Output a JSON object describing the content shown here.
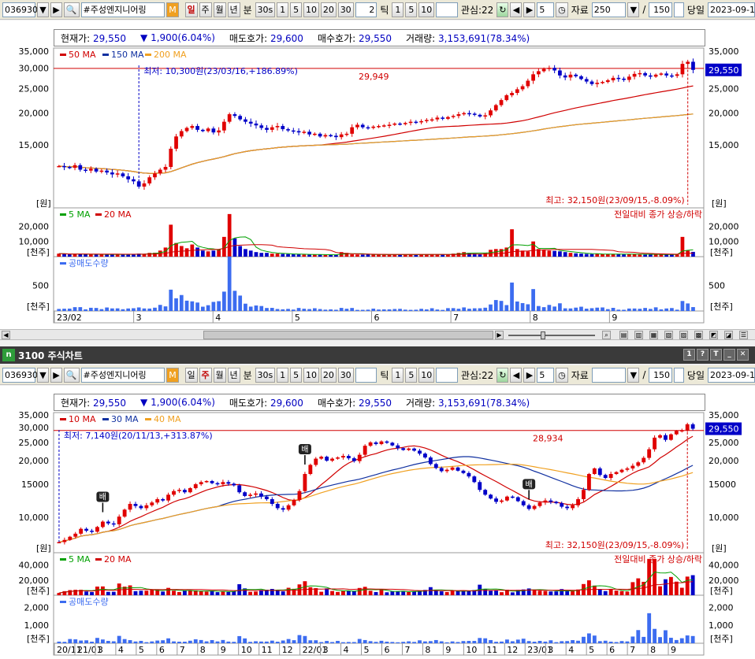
{
  "window_title": "3100 주식차트",
  "toolbar_top": {
    "code": "036930",
    "stock_name": "#주성엔지니어링",
    "period_tabs": [
      "일",
      "주",
      "월",
      "년"
    ],
    "active_period": "일",
    "min_label": "분",
    "sec_value": "30s",
    "intervals": [
      "1",
      "5",
      "10",
      "20",
      "30"
    ],
    "tick_value": "2",
    "tick_label": "틱",
    "tick_intervals": [
      "1",
      "5",
      "10"
    ],
    "interest_label": "관심:22",
    "spin_value": "5",
    "data_label": "자료",
    "data_count": "250",
    "slash": "/",
    "data_max": "150",
    "today_label": "당일",
    "date_value": "2023-09-1"
  },
  "toolbar_bottom": {
    "code": "036930",
    "stock_name": "#주성엔지니어링",
    "period_tabs": [
      "일",
      "주",
      "월",
      "년"
    ],
    "active_period": "주",
    "min_label": "분",
    "sec_value": "30s",
    "intervals": [
      "1",
      "5",
      "10",
      "20",
      "30"
    ],
    "tick_value": "",
    "tick_label": "틱",
    "tick_intervals": [
      "1",
      "5",
      "10"
    ],
    "interest_label": "관심:22",
    "spin_value": "5",
    "data_label": "자료",
    "slash": "/",
    "data_max": "150",
    "today_label": "당일",
    "date_value": "2023-09-1"
  },
  "info_bar": {
    "current_label": "현재가:",
    "current": "29,550",
    "change_arrow": "▼",
    "change": "1,900(6.04%)",
    "ask_label": "매도호가:",
    "ask": "29,600",
    "bid_label": "매수호가:",
    "bid": "29,550",
    "volume_label": "거래량:",
    "volume": "3,153,691(78.34%)"
  },
  "colors": {
    "up": "#e00000",
    "down": "#0000c8",
    "ma_red": "#d00000",
    "ma_blue": "#1030a0",
    "ma_orange": "#f0a020",
    "ma_green": "#00a000",
    "short_vol": "#3c6cf0"
  },
  "chart_data": [
    {
      "type": "candlestick",
      "name": "daily",
      "legend": [
        {
          "name": "50 MA",
          "color": "#d00000"
        },
        {
          "name": "150 MA",
          "color": "#1030a0"
        },
        {
          "name": "200 MA",
          "color": "#f0a020"
        }
      ],
      "y_ticks": [
        "35,000",
        "30,000",
        "25,000",
        "20,000",
        "15,000"
      ],
      "y_tick_values": [
        35000,
        30000,
        25000,
        20000,
        15000
      ],
      "y_unit": "[원]",
      "ylim": [
        8500,
        36000
      ],
      "current_price_label": "29,550",
      "current_price": 29550,
      "ref_line_value": 29949,
      "ref_line_label": "29,949",
      "low_annotation": "최저: 10,300원(23/03/16,+186.89%)",
      "high_annotation": "최고: 32,150원(23/09/15,-8.09%)",
      "x_labels": [
        "23/02",
        "3",
        "4",
        "5",
        "6",
        "7",
        "8",
        "9"
      ],
      "volume_legend": [
        {
          "name": "5 MA",
          "color": "#00a000"
        },
        {
          "name": "20 MA",
          "color": "#d00000"
        }
      ],
      "volume_note": "전일대비 종가 상승/하락",
      "volume_ticks": [
        "20,000",
        "10,000"
      ],
      "volume_tick_values": [
        20000,
        10000
      ],
      "volume_unit": "[천주]",
      "short_legend": "공매도수량",
      "short_ticks": [
        "500"
      ],
      "short_tick_values": [
        500
      ],
      "short_unit": "[천주]",
      "close": [
        12400,
        12300,
        12200,
        12500,
        12000,
        11900,
        12100,
        11800,
        11900,
        11700,
        11500,
        11600,
        11300,
        11000,
        10800,
        10300,
        10600,
        11200,
        11600,
        12000,
        12300,
        14500,
        16200,
        17000,
        17500,
        17800,
        17200,
        17000,
        17400,
        16800,
        17100,
        18500,
        19800,
        19500,
        18900,
        18500,
        18200,
        17900,
        17500,
        17200,
        17600,
        17800,
        17300,
        17100,
        17000,
        16800,
        16900,
        16500,
        16600,
        16200,
        16400,
        16300,
        16100,
        16500,
        16600,
        17600,
        18000,
        17600,
        17500,
        17700,
        17800,
        17900,
        18000,
        18200,
        18100,
        18300,
        18500,
        18400,
        18600,
        18800,
        18900,
        19200,
        19000,
        19300,
        19500,
        19800,
        20000,
        19900,
        19700,
        19400,
        19600,
        20500,
        21500,
        22500,
        23500,
        24000,
        24800,
        25500,
        26800,
        28400,
        29200,
        29800,
        30100,
        29400,
        28100,
        27600,
        28300,
        27900,
        27200,
        26600,
        26000,
        26300,
        26500,
        26900,
        27500,
        27300,
        27000,
        27800,
        28500,
        28700,
        28100,
        27800,
        28300,
        28600,
        28100,
        28000,
        28400,
        31200,
        31800,
        29550
      ],
      "volume": [
        2000,
        1800,
        1500,
        1700,
        1900,
        1600,
        1400,
        1500,
        1300,
        1600,
        1800,
        1500,
        1400,
        1300,
        1700,
        2000,
        1800,
        2500,
        2600,
        4000,
        6000,
        21000,
        9000,
        7000,
        5500,
        8000,
        6000,
        4000,
        3500,
        4000,
        4500,
        13000,
        28000,
        12000,
        7000,
        5000,
        4000,
        3000,
        2500,
        2500,
        2000,
        2000,
        1800,
        1700,
        1500,
        1500,
        1400,
        1400,
        1300,
        1300,
        1200,
        1300,
        1200,
        3000,
        2500,
        1500,
        1400,
        1300,
        1500,
        1400,
        1300,
        1200,
        1300,
        1500,
        1400,
        1300,
        1400,
        1200,
        1300,
        1600,
        1500,
        1400,
        1300,
        1500,
        2000,
        2500,
        3000,
        2500,
        2000,
        1800,
        2500,
        4500,
        5000,
        5000,
        6000,
        18000,
        5000,
        4000,
        3500,
        10000,
        5000,
        4500,
        4000,
        3800,
        3500,
        3000,
        2500,
        2200,
        2000,
        1800,
        1700,
        1800,
        1600,
        1700,
        1800,
        1600,
        1500,
        1600,
        1700,
        1500,
        1400,
        1500,
        1600,
        1400,
        1300,
        1300,
        1400,
        13000,
        4000,
        3153
      ]
    },
    {
      "type": "candlestick",
      "name": "weekly",
      "legend": [
        {
          "name": "10 MA",
          "color": "#d00000"
        },
        {
          "name": "30 MA",
          "color": "#1030a0"
        },
        {
          "name": "40 MA",
          "color": "#f0a020"
        }
      ],
      "y_ticks": [
        "35,000",
        "30,000",
        "25,000",
        "20,000",
        "15000",
        "10,000"
      ],
      "y_tick_values": [
        35000,
        30000,
        25000,
        20000,
        15000,
        10000
      ],
      "y_unit": "[원]",
      "ylim": [
        6500,
        36000
      ],
      "current_price_label": "29,550",
      "current_price": 29550,
      "ref_line_value": 28934,
      "ref_line_label": "28,934",
      "low_annotation": "최저: 7,140원(20/11/13,+313.87%)",
      "high_annotation": "최고: 32,150원(23/09/15,-8.09%)",
      "markers": [
        "배",
        "배",
        "배"
      ],
      "x_labels": [
        "20/11",
        "21/01",
        "3",
        "4",
        "5",
        "6",
        "7",
        "8",
        "9",
        "10",
        "11",
        "12",
        "22/01",
        "3",
        "4",
        "5",
        "6",
        "7",
        "8",
        "9",
        "10",
        "11",
        "12",
        "23/01",
        "3",
        "4",
        "5",
        "6",
        "7",
        "8",
        "9"
      ],
      "volume_legend": [
        {
          "name": "5 MA",
          "color": "#00a000"
        },
        {
          "name": "20 MA",
          "color": "#d00000"
        }
      ],
      "volume_note": "전일대비 종가 상승/하락",
      "volume_ticks": [
        "40,000",
        "20,000"
      ],
      "volume_tick_values": [
        40000,
        20000
      ],
      "volume_unit": "[천주]",
      "short_legend": "공매도수량",
      "short_ticks": [
        "2,000",
        "1,000"
      ],
      "short_tick_values": [
        2000,
        1000
      ],
      "short_unit": "[천주]",
      "close": [
        7400,
        7600,
        7900,
        8200,
        8700,
        8500,
        8400,
        8900,
        9500,
        9300,
        9200,
        10100,
        11000,
        11800,
        11500,
        11200,
        11600,
        12000,
        12500,
        12300,
        13200,
        13800,
        14000,
        13600,
        14300,
        15000,
        15400,
        15600,
        15200,
        15000,
        15400,
        15100,
        14800,
        13600,
        13000,
        13200,
        13400,
        12900,
        12500,
        11800,
        11200,
        11000,
        11600,
        12400,
        13800,
        17000,
        19000,
        20500,
        21000,
        20000,
        20500,
        20800,
        21200,
        20600,
        19900,
        21500,
        24000,
        25000,
        24500,
        25300,
        24900,
        24100,
        23300,
        22800,
        23200,
        22600,
        21800,
        20800,
        19200,
        18300,
        17600,
        17900,
        18400,
        17700,
        17200,
        16500,
        15400,
        14000,
        13200,
        12600,
        12100,
        12300,
        12900,
        12800,
        12200,
        11600,
        11100,
        11500,
        12000,
        12300,
        12100,
        11900,
        11400,
        11200,
        11600,
        12500,
        14000,
        17000,
        18200,
        16800,
        16200,
        17000,
        17400,
        17900,
        18200,
        18800,
        19600,
        20700,
        23000,
        26500,
        27300,
        25800,
        27600,
        28800,
        29000,
        31200,
        29550
      ]
    }
  ]
}
